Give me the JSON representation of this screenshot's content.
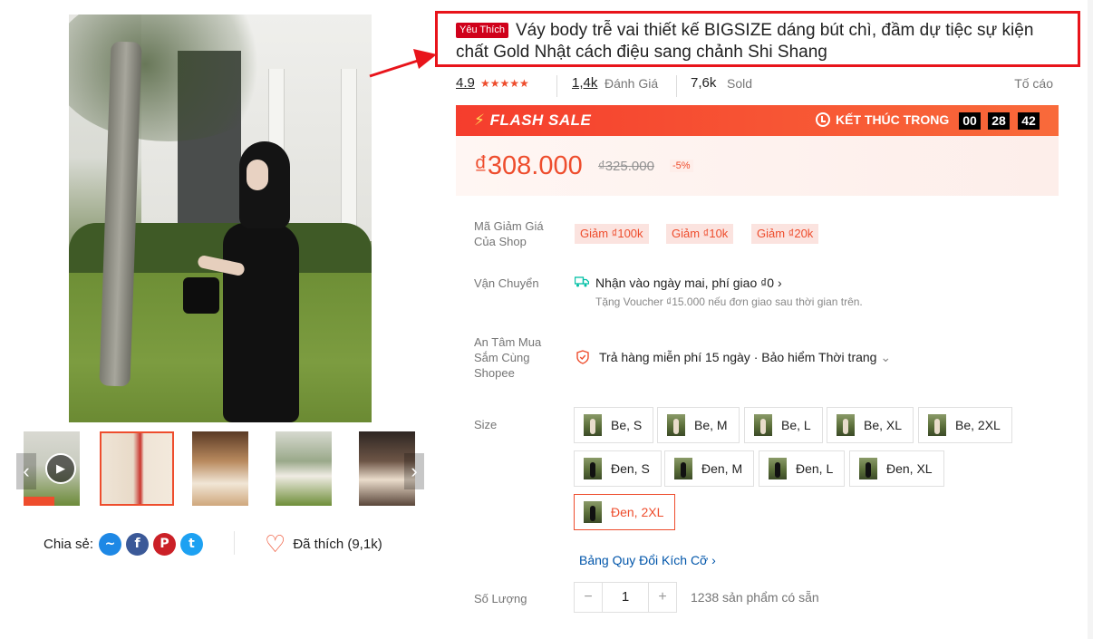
{
  "product": {
    "favorite_badge": "Yêu Thích",
    "title": "Váy body trễ vai thiết kế BIGSIZE dáng bút chì, đầm dự tiệc sự kiện chất Gold Nhật cách điệu sang chảnh Shi Shang"
  },
  "stats": {
    "rating": "4.9",
    "review_count": "1,4k",
    "review_label": "Đánh Giá",
    "sold_count": "7,6k",
    "sold_label": "Sold",
    "report_label": "Tố cáo"
  },
  "flash_sale": {
    "title": "FLASH SALE",
    "bolt": "⚡",
    "ends_label": "KẾT THÚC TRONG",
    "countdown": [
      "00",
      "28",
      "42"
    ]
  },
  "price": {
    "current": "₫308.000",
    "original": "₫325.000",
    "discount": "-5%"
  },
  "vouchers": {
    "label_line1": "Mã Giảm Giá",
    "label_line2": "Của Shop",
    "items": [
      "Giảm ₫100k",
      "Giảm ₫10k",
      "Giảm ₫20k"
    ]
  },
  "shipping": {
    "label": "Vận Chuyển",
    "main": "Nhận vào ngày mai, phí giao ₫0",
    "chevron": "›",
    "sub": "Tặng Voucher ₫15.000 nếu đơn giao sau thời gian trên."
  },
  "guarantee": {
    "label_line1": "An Tâm Mua",
    "label_line2": "Sắm Cùng",
    "label_line3": "Shopee",
    "text": "Trả hàng miễn phí 15 ngày · Bảo hiểm Thời trang",
    "chevron": "⌄"
  },
  "size": {
    "label": "Size",
    "options": [
      "Be, S",
      "Be, M",
      "Be, L",
      "Be, XL",
      "Be, 2XL",
      "Đen, S",
      "Đen, M",
      "Đen, L",
      "Đen, XL",
      "Đen, 2XL"
    ],
    "selected": "Đen, 2XL",
    "chart_link": "Bảng Quy Đổi Kích Cỡ",
    "chart_chevron": "›"
  },
  "quantity": {
    "label": "Số Lượng",
    "minus": "−",
    "value": "1",
    "plus": "+",
    "stock": "1238 sản phẩm có sẵn"
  },
  "share": {
    "label": "Chia sẻ:",
    "messenger_glyph": "~",
    "facebook_glyph": "f",
    "pinterest_glyph": "P",
    "twitter_glyph": "t"
  },
  "like": {
    "heart": "♡",
    "label": "Đã thích (9,1k)"
  },
  "gallery": {
    "prev": "‹",
    "next": "›",
    "play": "▶"
  },
  "colors": {
    "accent": "#ee4d2d",
    "highlight_border": "#e8141b",
    "link": "#0055aa",
    "messenger": "#1e88e5",
    "facebook": "#3b5998",
    "pinterest": "#cb2027",
    "twitter": "#1da1f2"
  }
}
